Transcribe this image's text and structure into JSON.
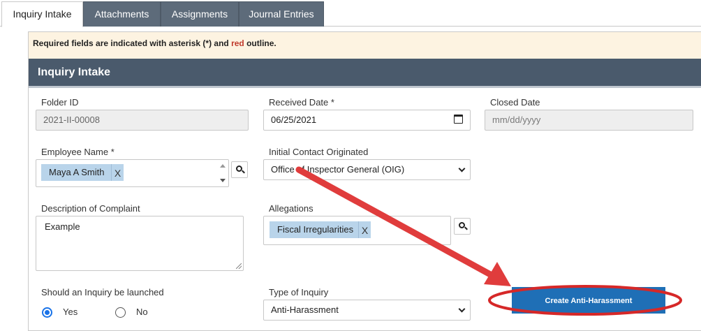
{
  "tabs": [
    {
      "label": "Inquiry Intake",
      "active": true
    },
    {
      "label": "Attachments",
      "active": false
    },
    {
      "label": "Assignments",
      "active": false
    },
    {
      "label": "Journal Entries",
      "active": false
    }
  ],
  "notice": {
    "prefix": "Required fields are indicated with asterisk (*) and ",
    "red": "red",
    "suffix": " outline."
  },
  "section_title": "Inquiry Intake",
  "folder_id": {
    "label": "Folder ID",
    "value": "2021-II-00008"
  },
  "received_date": {
    "label": "Received Date *",
    "value": "06/25/2021"
  },
  "closed_date": {
    "label": "Closed Date",
    "placeholder": "mm/dd/yyyy"
  },
  "employee_name": {
    "label": "Employee Name *",
    "chip": "Maya A Smith",
    "remove": "X"
  },
  "initial_contact": {
    "label": "Initial Contact Originated",
    "value": "Office of Inspector General (OIG)"
  },
  "description": {
    "label": "Description of Complaint",
    "value": "Example"
  },
  "allegations": {
    "label": "Allegations",
    "chip": "Fiscal Irregularities",
    "remove": "X"
  },
  "launch_inquiry": {
    "label": "Should an Inquiry be launched",
    "yes": "Yes",
    "no": "No",
    "selected": "Yes"
  },
  "type_of_inquiry": {
    "label": "Type of Inquiry",
    "value": "Anti-Harassment"
  },
  "create_button": {
    "label": "Create Anti-Harassment"
  },
  "colors": {
    "header": "#4a5a6c",
    "tab": "#5d6b7a",
    "notice_bg": "#fdf3e1",
    "chip": "#b9d4ea",
    "button": "#1f6fb6",
    "annotation": "#e03c3c"
  }
}
